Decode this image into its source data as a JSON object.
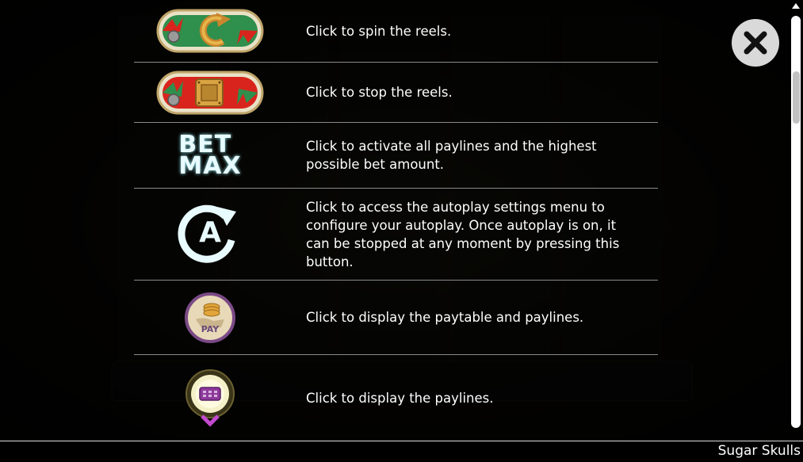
{
  "help": {
    "items": [
      {
        "icon": "spin-button-icon",
        "text": "Click to spin the reels."
      },
      {
        "icon": "stop-button-icon",
        "text": "Click to stop the reels."
      },
      {
        "icon": "bet-max-icon",
        "icon_label_top": "BET",
        "icon_label_bottom": "MAX",
        "text": "Click to activate all paylines and the highest possible bet amount."
      },
      {
        "icon": "autoplay-icon",
        "icon_letter": "A",
        "text": "Click to access the autoplay settings menu to configure your autoplay. Once autoplay is on, it can be stopped at any moment by pressing this button."
      },
      {
        "icon": "paytable-icon",
        "icon_label": "PAY",
        "text": "Click to display the paytable and paylines."
      },
      {
        "icon": "paylines-icon",
        "text": "Click to display the paylines."
      }
    ]
  },
  "close": {
    "icon": "close-icon"
  },
  "footer": {
    "title": "Sugar Skulls"
  },
  "colors": {
    "accent_green": "#3aa35a",
    "accent_red": "#d8241c",
    "gold": "#d9a441",
    "pay_purple": "#7a4a86",
    "paylines_purple": "#8e3a9c",
    "cyan_text": "#e8fbff"
  }
}
